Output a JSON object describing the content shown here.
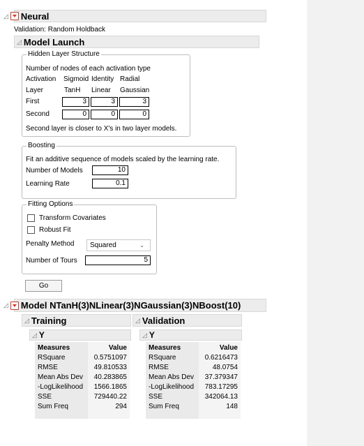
{
  "report": {
    "title": "Neural",
    "validation_text": "Validation: Random Holdback"
  },
  "model_launch": {
    "title": "Model Launch",
    "hidden_layer": {
      "legend": "Hidden Layer Structure",
      "subtitle": "Number of nodes of each activation type",
      "header_row1": [
        "Activation",
        "Sigmoid",
        "Identity",
        "Radial"
      ],
      "header_row2": [
        "Layer",
        "TanH",
        "Linear",
        "Gaussian"
      ],
      "rows": [
        {
          "label": "First",
          "values": [
            "3",
            "3",
            "3"
          ]
        },
        {
          "label": "Second",
          "values": [
            "0",
            "0",
            "0"
          ]
        }
      ],
      "note": "Second layer is closer to X's in two layer models."
    },
    "boosting": {
      "legend": "Boosting",
      "description": "Fit an additive sequence of models scaled by the learning rate.",
      "num_models_label": "Number of Models",
      "num_models_value": "10",
      "learning_rate_label": "Learning Rate",
      "learning_rate_value": "0.1"
    },
    "fitting": {
      "legend": "Fitting Options",
      "transform_label": "Transform Covariates",
      "robust_label": "Robust Fit",
      "penalty_label": "Penalty Method",
      "penalty_value": "Squared",
      "tours_label": "Number of Tours",
      "tours_value": "5"
    },
    "go_label": "Go"
  },
  "model": {
    "title": "Model NTanH(3)NLinear(3)NGaussian(3)NBoost(10)",
    "training": {
      "title": "Training",
      "y_label": "Y",
      "col_measures": "Measures",
      "col_value": "Value",
      "rows": [
        {
          "m": "RSquare",
          "v": "0.5751097"
        },
        {
          "m": "RMSE",
          "v": "49.810533"
        },
        {
          "m": "Mean Abs Dev",
          "v": "40.283865"
        },
        {
          "m": "-LogLikelihood",
          "v": "1566.1865"
        },
        {
          "m": "SSE",
          "v": "729440.22"
        },
        {
          "m": "Sum Freq",
          "v": "294"
        }
      ]
    },
    "validation": {
      "title": "Validation",
      "y_label": "Y",
      "col_measures": "Measures",
      "col_value": "Value",
      "rows": [
        {
          "m": "RSquare",
          "v": "0.6216473"
        },
        {
          "m": "RMSE",
          "v": "48.0754"
        },
        {
          "m": "Mean Abs Dev",
          "v": "37.379347"
        },
        {
          "m": "-LogLikelihood",
          "v": "783.17295"
        },
        {
          "m": "SSE",
          "v": "342064.13"
        },
        {
          "m": "Sum Freq",
          "v": "148"
        }
      ]
    }
  }
}
